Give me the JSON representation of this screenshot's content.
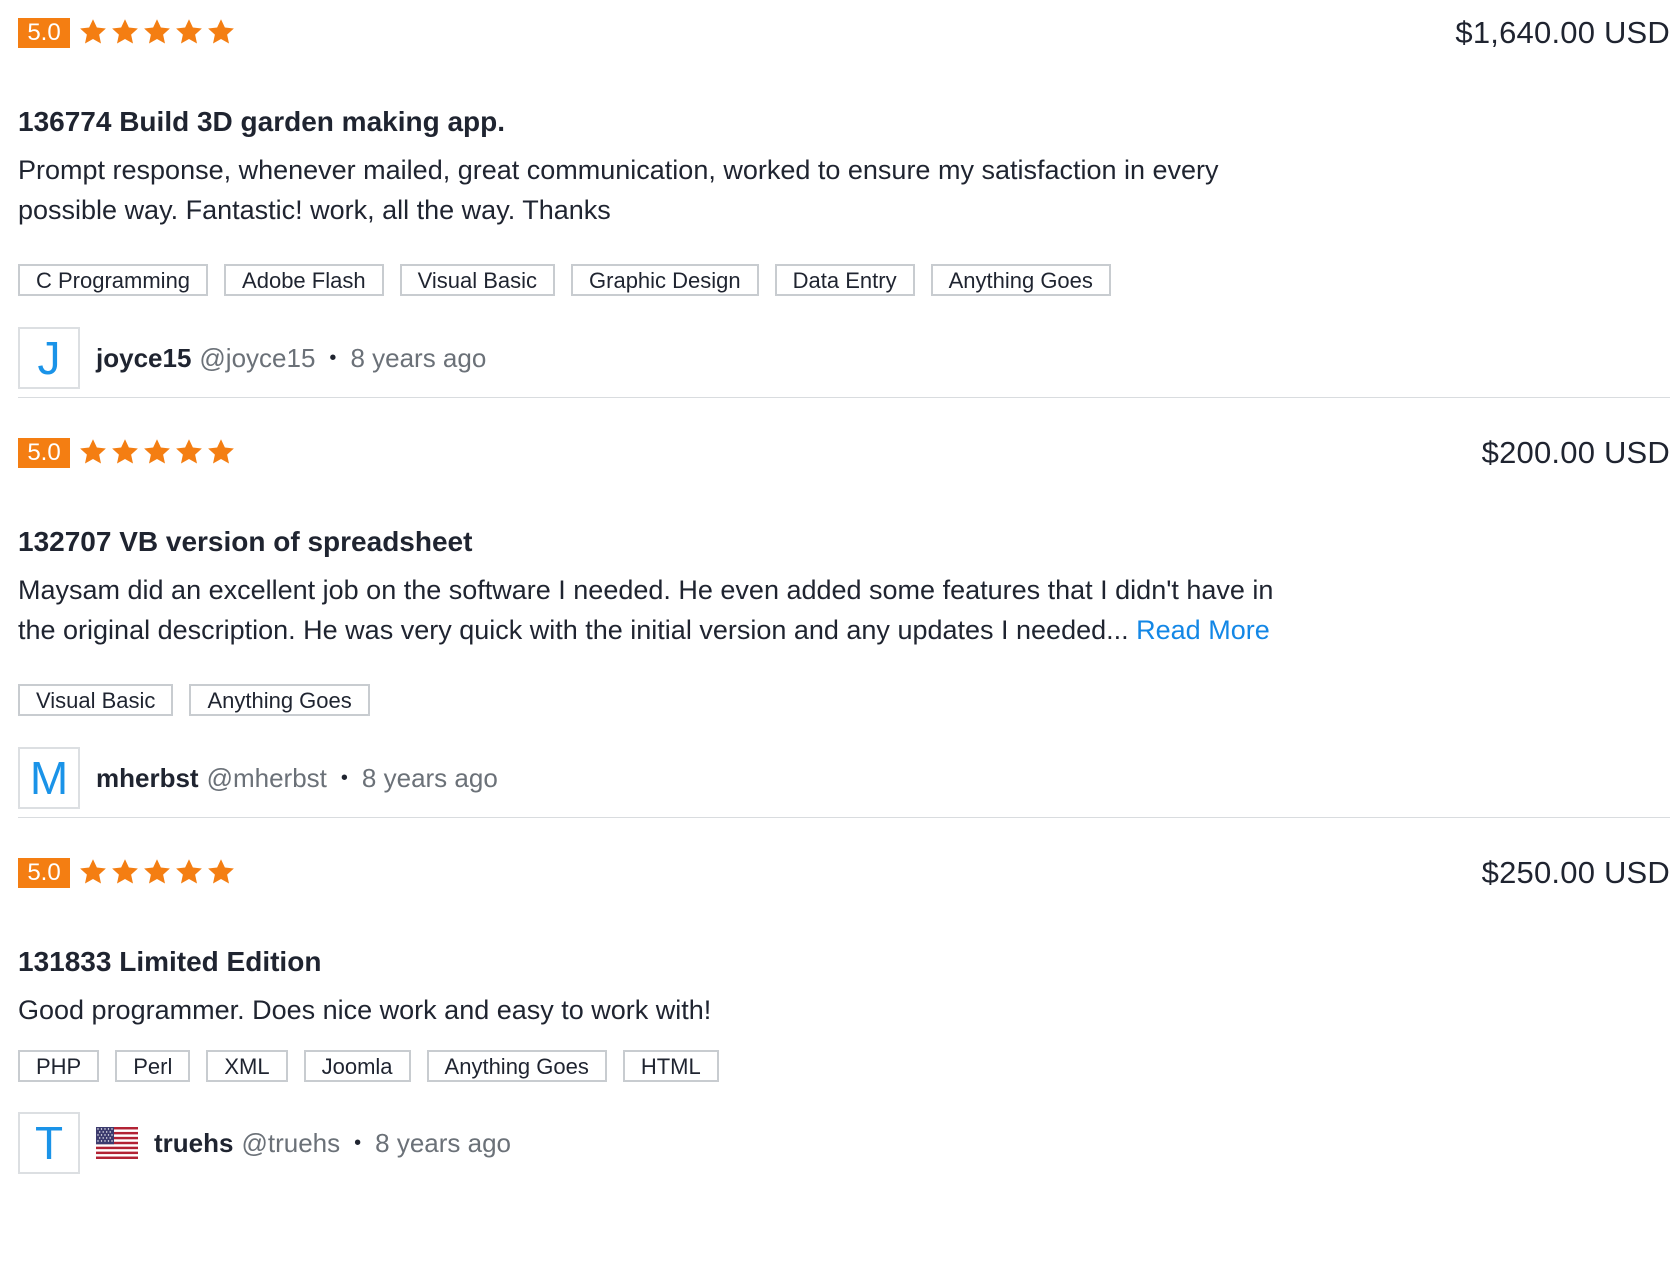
{
  "colors": {
    "rating_badge": "#f47e12",
    "star": "#f47e12",
    "link": "#1387e6",
    "avatar_letter": "#1a93e8"
  },
  "reviews": [
    {
      "rating": "5.0",
      "stars": 5,
      "amount": "$1,640.00 USD",
      "title": "136774 Build 3D garden making app.",
      "description": "Prompt response, whenever mailed, great communication, worked to ensure my satisfaction in every possible way. Fantastic! work, all the way. Thanks",
      "read_more": "",
      "tags": [
        "C Programming",
        "Adobe Flash",
        "Visual Basic",
        "Graphic Design",
        "Data Entry",
        "Anything Goes"
      ],
      "avatar_letter": "J",
      "flag": "",
      "username": "joyce15",
      "handle": "@joyce15",
      "separator": "•",
      "time": "8 years ago"
    },
    {
      "rating": "5.0",
      "stars": 5,
      "amount": "$200.00 USD",
      "title": "132707 VB version of spreadsheet",
      "description": "Maysam did an excellent job on the software I needed. He even added some features that I didn't have in the original description. He was very quick with the initial version and any updates I needed...",
      "read_more": "Read More",
      "tags": [
        "Visual Basic",
        "Anything Goes"
      ],
      "avatar_letter": "M",
      "flag": "",
      "username": "mherbst",
      "handle": "@mherbst",
      "separator": "•",
      "time": "8 years ago"
    },
    {
      "rating": "5.0",
      "stars": 5,
      "amount": "$250.00 USD",
      "title": "131833 Limited Edition",
      "description": "Good programmer. Does nice work and easy to work with!",
      "read_more": "",
      "tags": [
        "PHP",
        "Perl",
        "XML",
        "Joomla",
        "Anything Goes",
        "HTML"
      ],
      "avatar_letter": "T",
      "flag": "us-flag-icon",
      "username": "truehs",
      "handle": "@truehs",
      "separator": "•",
      "time": "8 years ago"
    }
  ]
}
